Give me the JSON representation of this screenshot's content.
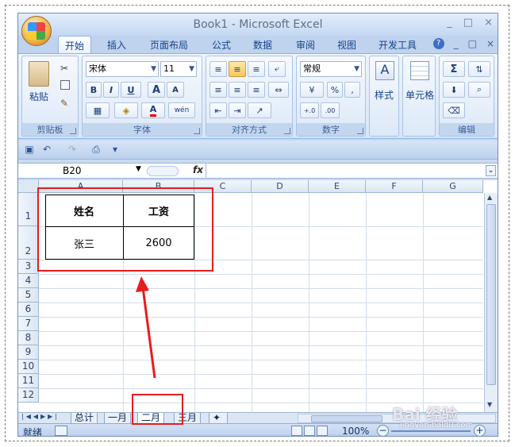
{
  "window": {
    "title": "Book1 - Microsoft Excel",
    "controls": [
      "_",
      "□",
      "×"
    ]
  },
  "ribbon_tabs": [
    "开始",
    "插入",
    "页面布局",
    "公式",
    "数据",
    "审阅",
    "视图",
    "开发工具"
  ],
  "ribbon_tab_active": "开始",
  "ribbon_right_controls": [
    "?",
    "_",
    "□",
    "×"
  ],
  "ribbon": {
    "clipboard": {
      "label": "剪贴板",
      "paste": "粘贴"
    },
    "font": {
      "label": "字体",
      "font_name": "宋体",
      "font_size": "11",
      "bold": "B",
      "italic": "I",
      "underline": "U",
      "grow": "A",
      "shrink": "A",
      "fill": "◈",
      "color": "A",
      "phonetic": "wén"
    },
    "alignment": {
      "label": "对齐方式"
    },
    "number": {
      "label": "数字",
      "format": "常规",
      "percent": "%",
      "comma": ",",
      "inc": "+.0",
      "dec": ".00"
    },
    "styles": {
      "label": "样式"
    },
    "cells": {
      "label": "单元格"
    },
    "editing": {
      "label": "编辑",
      "sum": "Σ"
    }
  },
  "formula_bar": {
    "name_box": "B20",
    "fx": "fx",
    "content": ""
  },
  "columns": [
    "A",
    "B",
    "C",
    "D",
    "E",
    "F",
    "G"
  ],
  "rows": [
    "1",
    "2",
    "3",
    "4",
    "5",
    "6",
    "7",
    "8",
    "9",
    "10",
    "11",
    "12"
  ],
  "cells": {
    "A1": "姓名",
    "B1": "工资",
    "A2": "张三",
    "B2": "2600"
  },
  "sheet_tabs": [
    "总计",
    "一月",
    "二月",
    "三月"
  ],
  "sheet_tab_active": "二月",
  "status": {
    "ready": "就绪",
    "zoom": "100%",
    "zoom_minus": "−",
    "zoom_plus": "+"
  },
  "watermark": {
    "main": "Bai 经验",
    "sub": "jingyan.baidu.com"
  },
  "colors": {
    "annotation": "#e81c1c",
    "accent": "#15428b"
  }
}
